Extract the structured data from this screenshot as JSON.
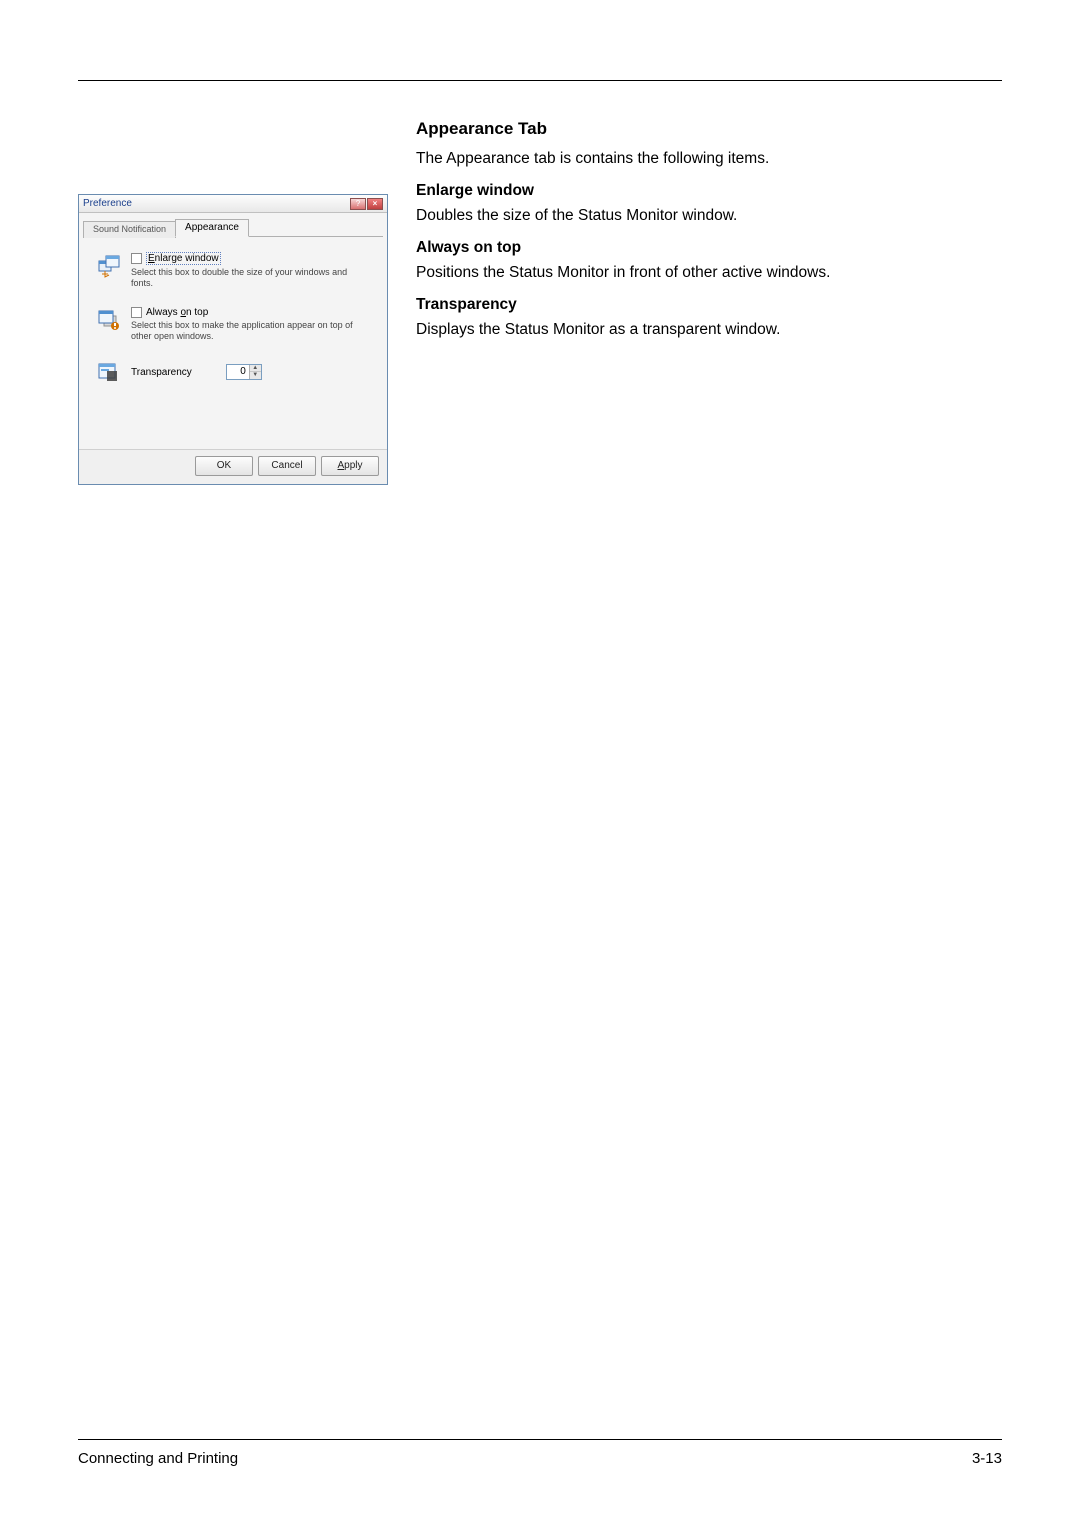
{
  "doc": {
    "heading": "Appearance Tab",
    "intro": "The Appearance tab is contains the following items.",
    "items": [
      {
        "title": "Enlarge window",
        "desc": "Doubles the size of the Status Monitor window."
      },
      {
        "title": "Always on top",
        "desc": "Positions the Status Monitor in front of other active windows."
      },
      {
        "title": "Transparency",
        "desc": "Displays the Status Monitor as a transparent window."
      }
    ]
  },
  "dialog": {
    "title": "Preference",
    "tabs": {
      "inactive": "Sound Notification",
      "active": "Appearance"
    },
    "enlarge": {
      "labelPrefix": "E",
      "labelRest": "nlarge window",
      "desc": "Select this box to double the size of your windows and fonts."
    },
    "ontop": {
      "labelPrefix": "Always ",
      "labelUL": "o",
      "labelSuffix": "n top",
      "desc": "Select this box to make the application appear on top of other open windows."
    },
    "transparency": {
      "labelUL": "T",
      "labelRest": "ransparency",
      "value": "0"
    },
    "buttons": {
      "ok": "OK",
      "cancel": "Cancel",
      "applyUL": "A",
      "applyRest": "pply"
    }
  },
  "footer": {
    "left": "Connecting and Printing",
    "right": "3-13"
  }
}
